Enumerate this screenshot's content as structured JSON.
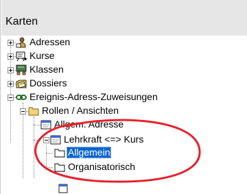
{
  "panel": {
    "title": "Karten"
  },
  "tree": {
    "adressen": {
      "label": "Adressen",
      "icon": "person-card-icon"
    },
    "kurse": {
      "label": "Kurse",
      "icon": "flip-chart-icon"
    },
    "klassen": {
      "label": "Klassen",
      "icon": "classroom-icon"
    },
    "dossiers": {
      "label": "Dossiers",
      "icon": "dossier-folder-icon"
    },
    "zuweisungen": {
      "label": "Ereignis-Adress-Zuweisungen",
      "icon": "link-icon"
    },
    "rollen": {
      "label": "Rollen / Ansichten",
      "icon": "folder-icon"
    },
    "allgem_adresse": {
      "label": "Allgem. Adresse",
      "icon": "view-icon"
    },
    "lehrkraft": {
      "label": "Lehrkraft <=> Kurs",
      "icon": "view-icon"
    },
    "allgemein": {
      "label": "Allgemein",
      "icon": "folder-icon",
      "selected": true
    },
    "organisatorisch": {
      "label": "Organisatorisch",
      "icon": "folder-icon"
    }
  },
  "colors": {
    "header_bg": "#e6e6e6",
    "selection": "#0a64d2",
    "annotation": "#e8202a",
    "folder": "#f2d57a"
  }
}
